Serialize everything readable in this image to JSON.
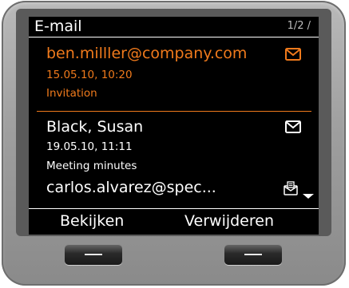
{
  "header": {
    "title": "E-mail",
    "page_indicator": "1/2 /"
  },
  "messages": [
    {
      "sender": "ben.milller@company.com",
      "date": "15.05.10, 10:20",
      "subject": "Invitation",
      "selected": true,
      "icon": "envelope-icon"
    },
    {
      "sender": "Black, Susan",
      "date": "19.05.10, 11:11",
      "subject": "Meeting minutes",
      "selected": false,
      "icon": "envelope-icon"
    },
    {
      "sender": "carlos.alvarez@spec...",
      "selected": false,
      "icon": "envelope-attachment-icon"
    }
  ],
  "softkeys": {
    "left": "Bekijken",
    "right": "Verwijderen"
  },
  "colors": {
    "accent": "#f07a1c",
    "screen_bg": "#000000",
    "text": "#ffffff",
    "device_body": "#a8a8a8"
  }
}
